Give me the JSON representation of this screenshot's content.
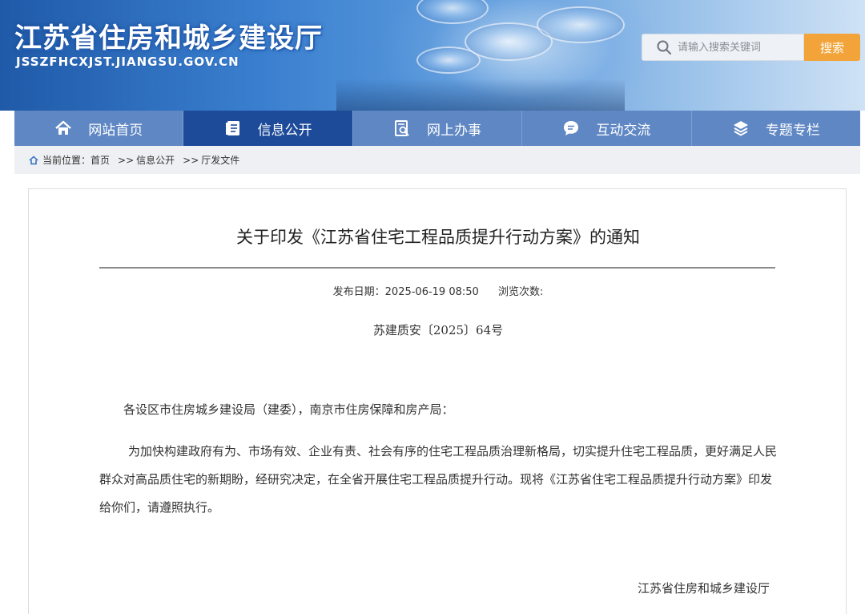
{
  "header": {
    "site_title": "江苏省住房和城乡建设厅",
    "site_url": "JSSZFHCXJST.JIANGSU.GOV.CN",
    "search": {
      "placeholder": "请输入搜索关键词",
      "button_label": "搜索"
    }
  },
  "nav": {
    "items": [
      {
        "label": "网站首页",
        "icon": "home-icon"
      },
      {
        "label": "信息公开",
        "icon": "document-icon",
        "active": true
      },
      {
        "label": "网上办事",
        "icon": "online-service-icon"
      },
      {
        "label": "互动交流",
        "icon": "chat-icon"
      },
      {
        "label": "专题专栏",
        "icon": "layers-icon"
      }
    ]
  },
  "breadcrumb": {
    "prefix": "当前位置：",
    "home": "首页",
    "sep": ">>",
    "level1": "信息公开",
    "level2": "厅发文件"
  },
  "article": {
    "title": "关于印发《江苏省住宅工程品质提升行动方案》的通知",
    "publish_date_label": "发布日期：",
    "publish_date": "2025-06-19 08:50",
    "views_label": "浏览次数:",
    "doc_number": "苏建质安〔2025〕64号",
    "salutation": "各设区市住房城乡建设局（建委），南京市住房保障和房产局：",
    "paragraph": "为加快构建政府有为、市场有效、企业有责、社会有序的住宅工程品质治理新格局，切实提升住宅工程品质，更好满足人民群众对高品质住宅的新期盼，经研究决定，在全省开展住宅工程品质提升行动。现将《江苏省住宅工程品质提升行动方案》印发给你们，请遵照执行。",
    "signature": "江苏省住房和城乡建设厅"
  },
  "colors": {
    "nav_bg": "#5f87c4",
    "nav_active": "#1d4b9a",
    "search_button": "#f2a43a"
  }
}
